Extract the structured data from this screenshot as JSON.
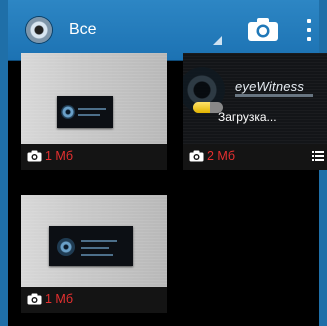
{
  "appbar": {
    "title": "Все",
    "icons": {
      "app": "app-logo-icon",
      "camera": "camera-icon",
      "overflow": "overflow-menu-icon"
    }
  },
  "tiles": [
    {
      "size": "1 Мб",
      "icon": "camera-icon"
    },
    {
      "size": "2 Мб",
      "icon": "camera-icon",
      "loading": {
        "brand": "eyeWitness",
        "text": "Загрузка...",
        "progress": 0.55
      },
      "menu_icon": "list-icon"
    },
    {
      "size": "1 Мб",
      "icon": "camera-icon"
    }
  ],
  "colors": {
    "appbar": "#1f78b8",
    "size_text": "#e53030",
    "progress": "#f0c419"
  }
}
